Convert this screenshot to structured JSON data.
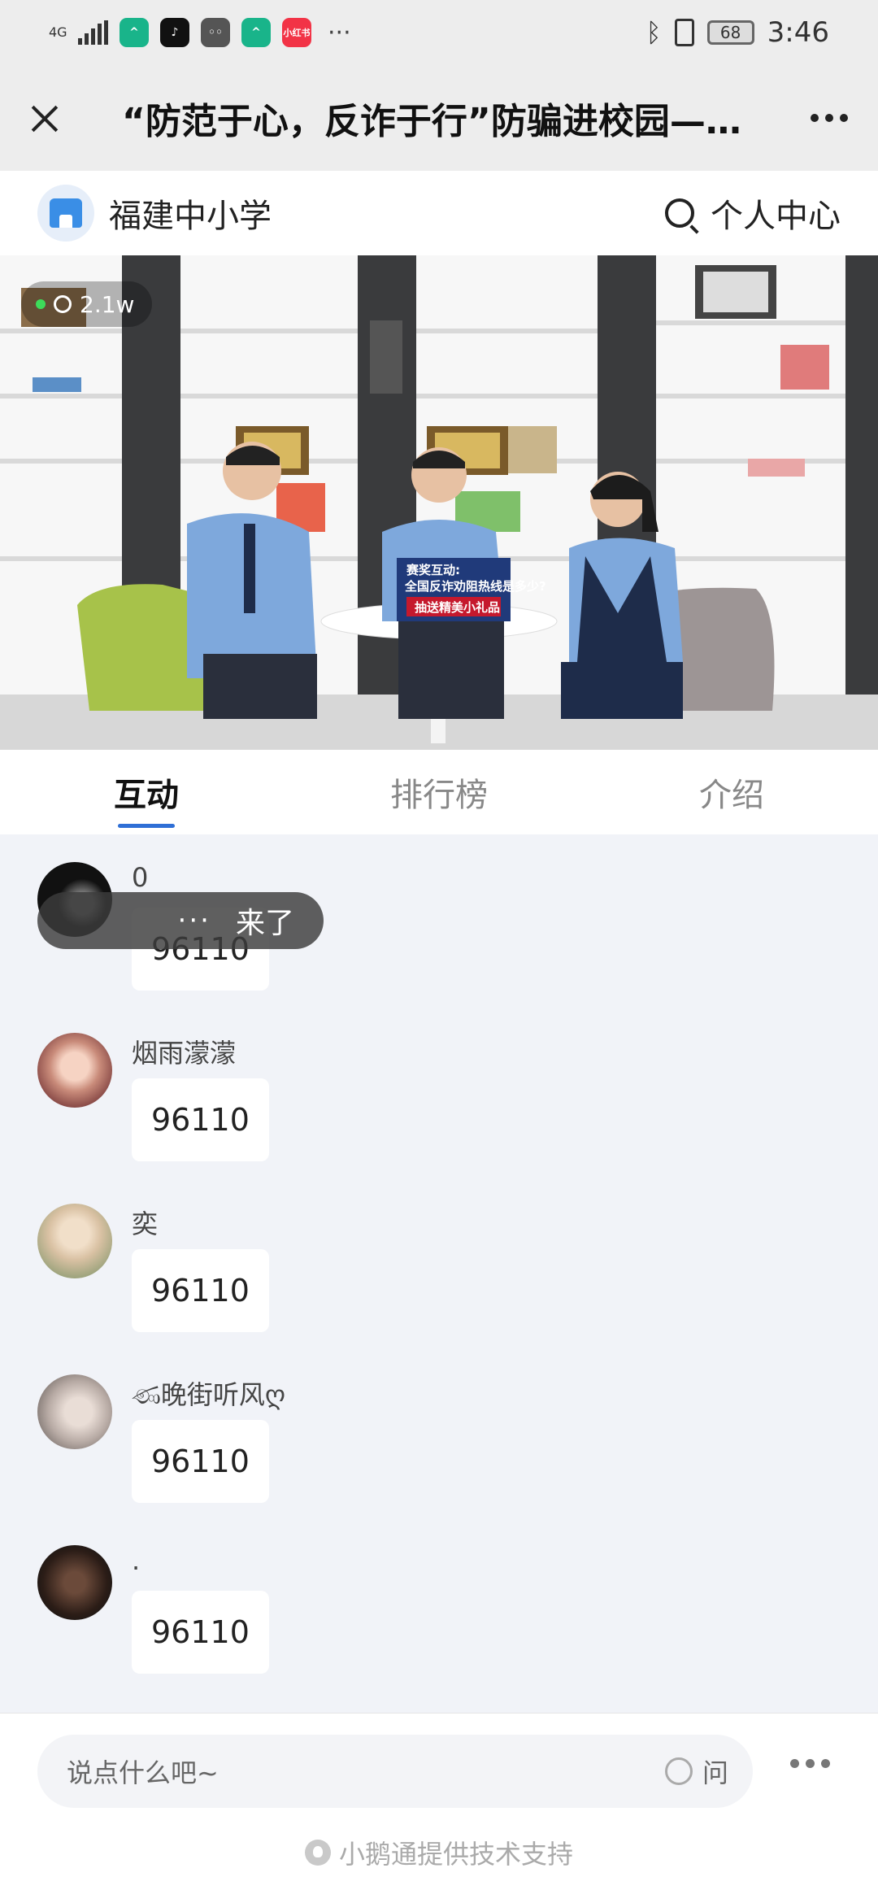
{
  "status_bar": {
    "network": "4G",
    "battery": "68",
    "time": "3:46",
    "apps": [
      "alipay-like-icon",
      "tiktok-icon",
      "wechat-icon",
      "alipay-like-icon",
      "xiaohongshu-icon"
    ],
    "xhs_label": "小红书",
    "more": "···"
  },
  "nav": {
    "title": "“防范于心，反诈于行”防骗进校园—…"
  },
  "shop": {
    "name": "福建中小学",
    "personal_center": "个人中心"
  },
  "video": {
    "viewers": "2.1w",
    "poster_line1": "赛奖互动:",
    "poster_line2": "全国反诈劝阻热线是多少?",
    "poster_line3": "抽送精美小礼品"
  },
  "tabs": [
    {
      "label": "互动",
      "active": true
    },
    {
      "label": "排行榜",
      "active": false
    },
    {
      "label": "介绍",
      "active": false
    }
  ],
  "comments": [
    {
      "name": "0",
      "text": "96110"
    },
    {
      "name": "烟雨濛濛",
      "text": "96110"
    },
    {
      "name": "奕",
      "text": "96110"
    },
    {
      "name": "ණ晚街听风ღ",
      "text": "96110"
    },
    {
      "name": ".",
      "text": "96110"
    }
  ],
  "toast": {
    "dots": "···",
    "text": "来了"
  },
  "bottom": {
    "input_placeholder": "说点什么吧~",
    "ask_label": "问",
    "powered_by": "小鹅通提供技术支持"
  },
  "colors": {
    "accent": "#2f6fd6",
    "live": "#3ddc5a"
  }
}
